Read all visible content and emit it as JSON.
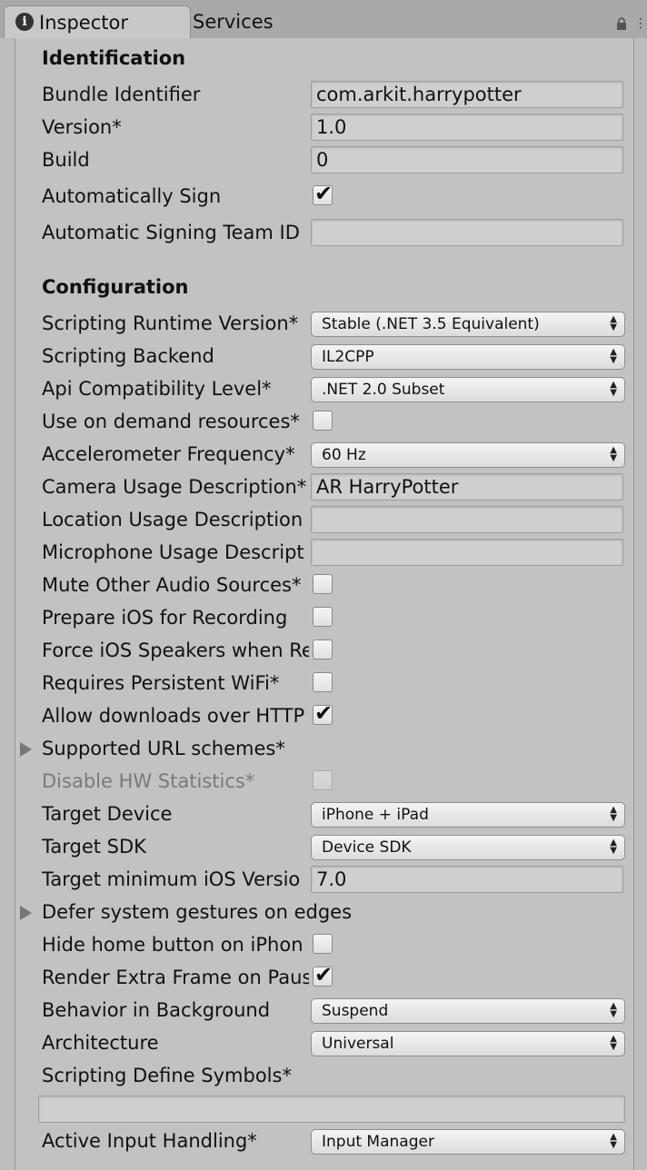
{
  "tabs": [
    {
      "label": "Inspector",
      "icon": "info-icon"
    },
    {
      "label": "Services"
    }
  ],
  "sections": {
    "identification": "Identification",
    "configuration": "Configuration"
  },
  "identification": {
    "bundle_identifier": {
      "label": "Bundle Identifier",
      "value": "com.arkit.harrypotter"
    },
    "version": {
      "label": "Version*",
      "value": "1.0"
    },
    "build": {
      "label": "Build",
      "value": "0"
    },
    "auto_sign": {
      "label": "Automatically Sign",
      "checked": true
    },
    "team_id": {
      "label": "Automatic Signing Team ID",
      "value": ""
    }
  },
  "configuration": {
    "scripting_runtime": {
      "label": "Scripting Runtime Version*",
      "value": "Stable (.NET 3.5 Equivalent)"
    },
    "scripting_backend": {
      "label": "Scripting Backend",
      "value": "IL2CPP"
    },
    "api_level": {
      "label": "Api Compatibility Level*",
      "value": ".NET 2.0 Subset"
    },
    "on_demand": {
      "label": "Use on demand resources*",
      "checked": false
    },
    "accel_freq": {
      "label": "Accelerometer Frequency*",
      "value": "60 Hz"
    },
    "camera_desc": {
      "label": "Camera Usage Description*",
      "value": "AR HarryPotter"
    },
    "location_desc": {
      "label": "Location Usage Description",
      "value": ""
    },
    "mic_desc": {
      "label": "Microphone Usage Descript",
      "value": ""
    },
    "mute_audio": {
      "label": "Mute Other Audio Sources*",
      "checked": false
    },
    "prepare_recording": {
      "label": "Prepare iOS for Recording",
      "checked": false
    },
    "force_speakers": {
      "label": "Force iOS Speakers when Re",
      "checked": false
    },
    "persistent_wifi": {
      "label": "Requires Persistent WiFi*",
      "checked": false
    },
    "allow_http": {
      "label": "Allow downloads over HTTP",
      "checked": true
    },
    "url_schemes": {
      "label": "Supported URL schemes*"
    },
    "disable_hw_stats": {
      "label": "Disable HW Statistics*",
      "checked": false,
      "disabled": true
    },
    "target_device": {
      "label": "Target Device",
      "value": "iPhone + iPad"
    },
    "target_sdk": {
      "label": "Target SDK",
      "value": "Device SDK"
    },
    "min_ios": {
      "label": "Target minimum iOS Versio",
      "value": "7.0"
    },
    "defer_gestures": {
      "label": "Defer system gestures on edges"
    },
    "hide_home": {
      "label": "Hide home button on iPhon",
      "checked": false
    },
    "render_extra": {
      "label": "Render Extra Frame on Paus",
      "checked": true
    },
    "bg_behavior": {
      "label": "Behavior in Background",
      "value": "Suspend"
    },
    "architecture": {
      "label": "Architecture",
      "value": "Universal"
    },
    "define_symbols": {
      "label": "Scripting Define Symbols*",
      "value": ""
    },
    "input_handling": {
      "label": "Active Input Handling*",
      "value": "Input Manager"
    }
  }
}
